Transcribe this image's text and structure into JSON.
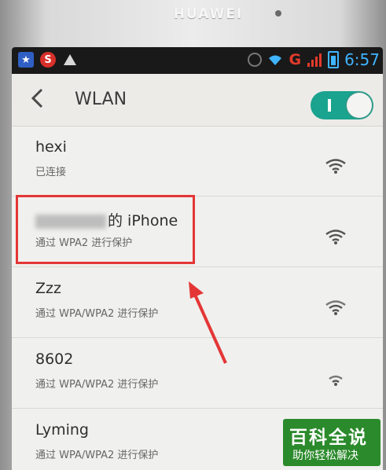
{
  "device": {
    "brand": "HUAWEI"
  },
  "statusbar": {
    "network": "G",
    "time": "6:57"
  },
  "header": {
    "title": "WLAN"
  },
  "networks": [
    {
      "name": "hexi",
      "status": "已连接"
    },
    {
      "name_suffix": "的 iPhone",
      "status": "通过 WPA2 进行保护"
    },
    {
      "name": "Zzz",
      "status": "通过 WPA/WPA2 进行保护"
    },
    {
      "name": "8602",
      "status": "通过 WPA/WPA2 进行保护"
    },
    {
      "name": "Lyming",
      "status": "通过 WPA/WPA2 进行保护"
    }
  ],
  "watermark": {
    "main": "百科全说",
    "sub": "助你轻松解决"
  },
  "colors": {
    "accent": "#1aa38e",
    "highlight": "#e43636",
    "watermark": "#2b8a2b"
  }
}
